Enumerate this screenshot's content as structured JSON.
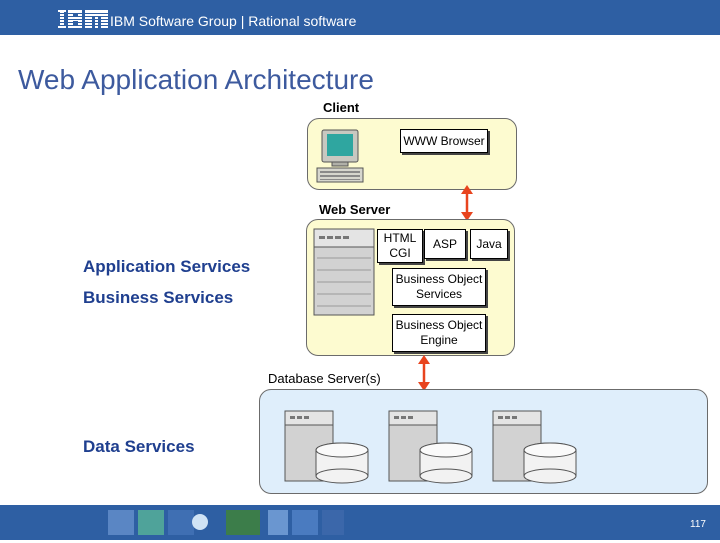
{
  "header": {
    "company_logo": "IBM",
    "text": "IBM Software Group | Rational software"
  },
  "title": "Web Application Architecture",
  "client": {
    "label": "Client",
    "browser": "WWW Browser"
  },
  "web_server": {
    "label": "Web Server",
    "html_cgi": "HTML\nCGI",
    "asp": "ASP",
    "java": "Java",
    "bo_services": "Business Object\nServices",
    "bo_engine": "Business Object\nEngine"
  },
  "database": {
    "label": "Database Server(s)"
  },
  "services": {
    "application": "Application Services",
    "business": "Business Services",
    "data": "Data Services"
  },
  "footer": {
    "page_number": "117"
  },
  "colors": {
    "brand_blue": "#2e5fa3",
    "title_blue": "#3d5a9e",
    "service_blue": "#1f3f8f",
    "arrow_orange": "#e8441e"
  }
}
